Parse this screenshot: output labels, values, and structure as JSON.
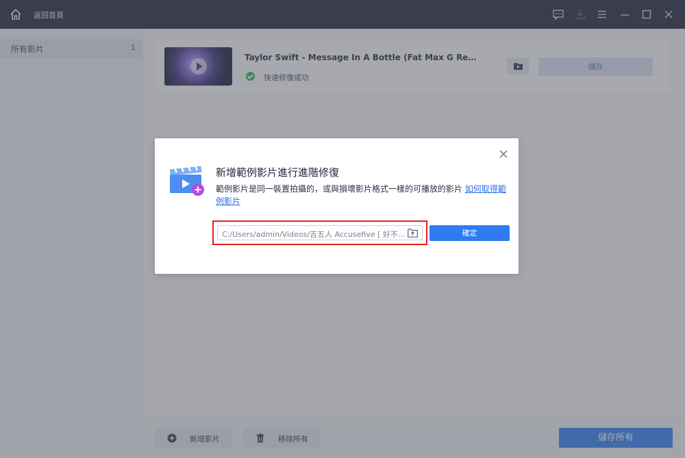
{
  "titlebar": {
    "back_label": "返回首頁",
    "icons": [
      "home-icon",
      "feedback-icon",
      "download-icon",
      "menu-icon",
      "minimize-icon",
      "maximize-icon",
      "close-icon"
    ]
  },
  "sidebar": {
    "items": [
      {
        "label": "所有影片",
        "count": "1"
      }
    ]
  },
  "video_list": {
    "items": [
      {
        "title": "Taylor Swift - Message In A Bottle (Fat Max G Remix) (Taylor'...",
        "status": "快速修復成功",
        "save_label": "儲存"
      }
    ]
  },
  "bottom_bar": {
    "add_label": "新增影片",
    "remove_label": "移除所有",
    "save_all_label": "儲存所有"
  },
  "dialog": {
    "title": "新增範例影片進行進階修復",
    "description": "範例影片是同一裝置拍攝的，或與損壞影片格式一樣的可播放的影片 ",
    "link_text": "如何取得範例影片",
    "path_value": "C:/Users/admin/Videos/吉五人 Accusefive [ 好不容...",
    "confirm_label": "確定"
  },
  "colors": {
    "titlebar": "#1e2338",
    "accent": "#2f7cf2",
    "highlight_border": "#e3201b",
    "success": "#22b35e"
  }
}
